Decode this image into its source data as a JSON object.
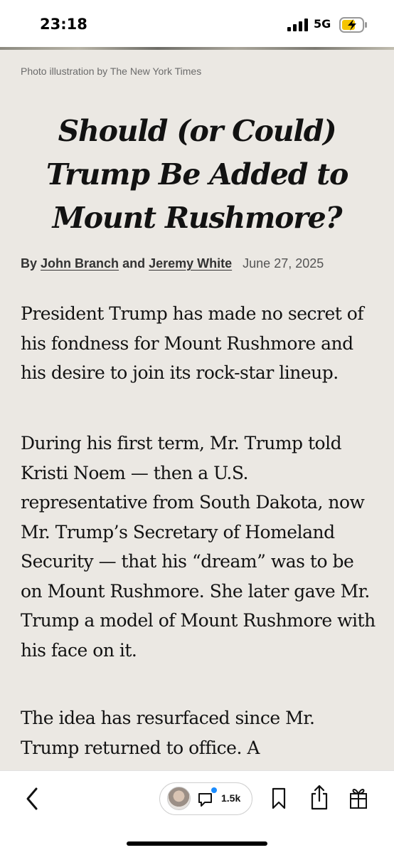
{
  "status_bar": {
    "time": "23:18",
    "network": "5G",
    "signal_icon": "cellular-signal-icon",
    "battery_icon": "battery-charging-icon",
    "battery_color": "#f5c400"
  },
  "article": {
    "photo_credit": "Photo illustration by The New York Times",
    "headline": "Should (or Could) Trump Be Added to Mount Rushmore?",
    "byline": {
      "prefix": "By",
      "author1": "John Branch",
      "conjunction": "and",
      "author2": "Jeremy White",
      "date": "June 27, 2025"
    },
    "paragraphs": [
      "President Trump has made no secret of his fondness for Mount Rushmore and his desire to join its rock-star lineup.",
      "During his first term, Mr. Trump told Kristi Noem — then a U.S. representative from South Dakota, now Mr. Trump’s Secretary of Homeland Security — that his “dream” was to be on Mount Rushmore. She later gave Mr. Trump a model of Mount Rushmore with his face on it.",
      "The idea has resurfaced since Mr. Trump returned to office. A"
    ],
    "background_color": "#ebe8e3"
  },
  "toolbar": {
    "back_icon": "chevron-left-icon",
    "comments_count": "1.5k",
    "comment_icon": "comment-bubble-icon",
    "bookmark_icon": "bookmark-icon",
    "share_icon": "share-icon",
    "gift_icon": "gift-icon",
    "notification_dot_color": "#1a8cff"
  }
}
